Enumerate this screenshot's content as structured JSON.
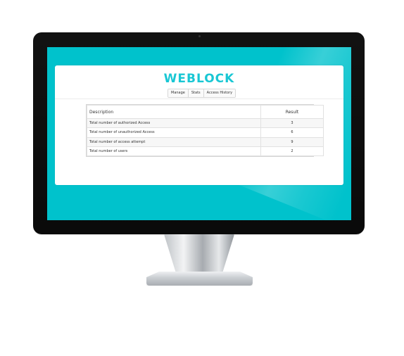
{
  "app": {
    "brand": "WEBLOCK",
    "nav_tabs": [
      {
        "label": "Manage"
      },
      {
        "label": "Stats"
      },
      {
        "label": "Access History"
      }
    ]
  },
  "stats_table": {
    "headers": {
      "description": "Description",
      "result": "Result"
    },
    "rows": [
      {
        "description": "Total number of authorized Access",
        "result": "3"
      },
      {
        "description": "Total number of unauthorized Access",
        "result": "6"
      },
      {
        "description": "Total number of access attempt",
        "result": "9"
      },
      {
        "description": "Total number of users",
        "result": "2"
      }
    ]
  },
  "colors": {
    "screen_bg": "#00c2cc",
    "brand": "#19c7d4",
    "bezel": "#0b0b0b"
  }
}
